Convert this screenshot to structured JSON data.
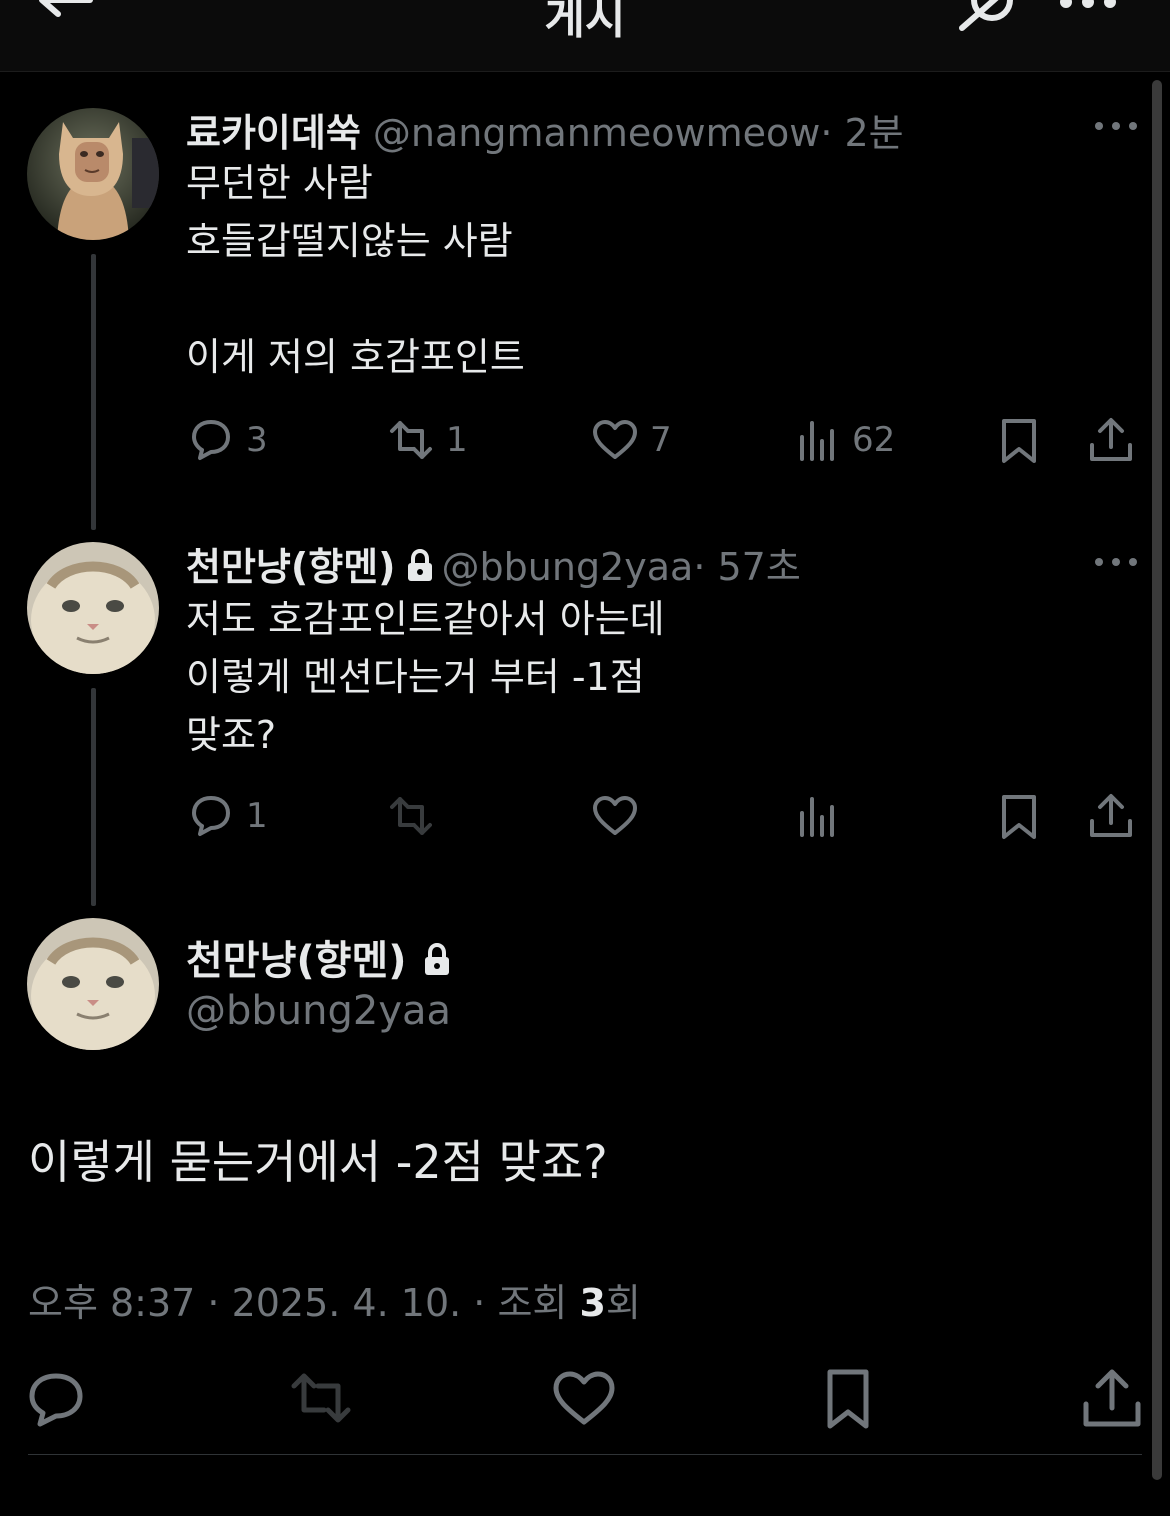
{
  "header": {
    "title": "게시",
    "back_icon": "arrow-left-icon",
    "grok_icon": "grok-icon",
    "more_icon": "more-horizontal-icon"
  },
  "tweets": [
    {
      "name": "료카이데쑥",
      "handle": "@nangmanmeowmeow",
      "time": "· 2분",
      "locked": false,
      "text": "무던한 사람\n호들갑떨지않는 사람\n\n이게 저의 호감포인트",
      "replies": "3",
      "retweets": "1",
      "likes": "7",
      "views": "62"
    },
    {
      "name": "천만냥(향멘)",
      "handle": "@bbung2yaa",
      "time": "· 57초",
      "locked": true,
      "text": "저도 호감포인트같아서 아는데\n이렇게 멘션다는거 부터 -1점\n맞죠?",
      "replies": "1",
      "retweets": "",
      "likes": "",
      "views": ""
    }
  ],
  "focus": {
    "name": "천만냥(향멘)",
    "handle": "@bbung2yaa",
    "text": "이렇게 묻는거에서 -2점 맞죠?",
    "meta_prefix": "오후 8:37 · 2025. 4. 10. · 조회 ",
    "views": "3",
    "views_suffix": "회"
  },
  "colors": {
    "background": "#000000",
    "text": "#e7e9ea",
    "muted": "#71767b",
    "thread_line": "#333639"
  }
}
